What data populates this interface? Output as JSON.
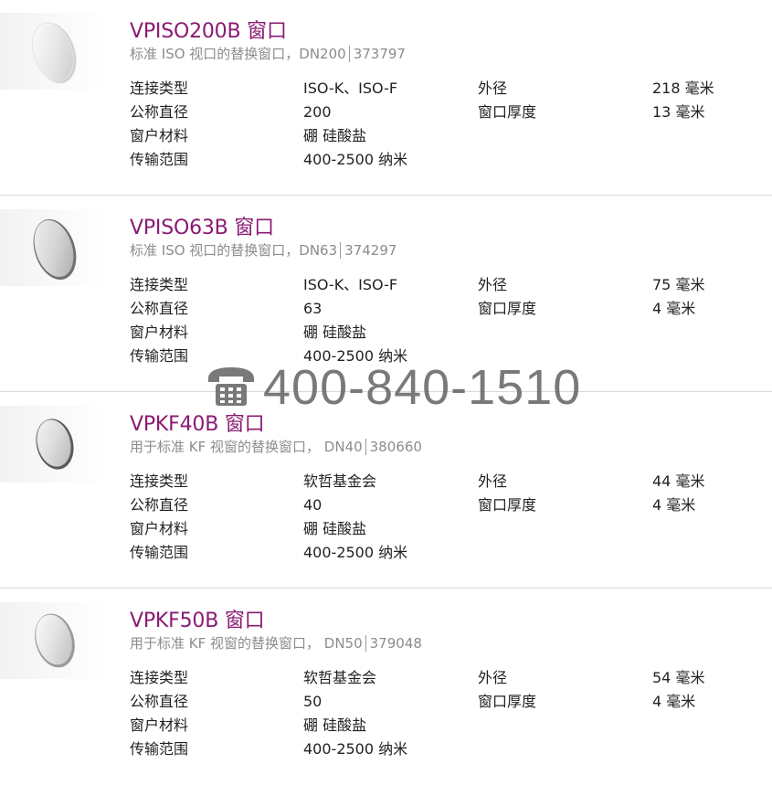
{
  "products": [
    {
      "title": "VPISO200B 窗口",
      "desc": "标准 ISO 视口的替换窗口，DN200",
      "part_no": "373797",
      "specs": [
        {
          "label": "连接类型",
          "value": "ISO-K、ISO-F",
          "label2": "外径",
          "value2": "218 毫米"
        },
        {
          "label": "公称直径",
          "value": "200",
          "label2": "窗口厚度",
          "value2": "13 毫米"
        },
        {
          "label": "窗户材料",
          "value": "硼 硅酸盐",
          "label2": "",
          "value2": ""
        },
        {
          "label": "传输范围",
          "value": "400-2500 纳米",
          "label2": "",
          "value2": ""
        }
      ]
    },
    {
      "title": "VPISO63B 窗口",
      "desc": "标准 ISO 视口的替换窗口，DN63",
      "part_no": "374297",
      "specs": [
        {
          "label": "连接类型",
          "value": "ISO-K、ISO-F",
          "label2": "外径",
          "value2": "75 毫米"
        },
        {
          "label": "公称直径",
          "value": "63",
          "label2": "窗口厚度",
          "value2": "4 毫米"
        },
        {
          "label": "窗户材料",
          "value": "硼 硅酸盐",
          "label2": "",
          "value2": ""
        },
        {
          "label": "传输范围",
          "value": "400-2500 纳米",
          "label2": "",
          "value2": ""
        }
      ]
    },
    {
      "title": "VPKF40B 窗口",
      "desc": "用于标准 KF 视窗的替换窗口， DN40",
      "part_no": "380660",
      "specs": [
        {
          "label": "连接类型",
          "value": "软哲基金会",
          "label2": "外径",
          "value2": "44 毫米"
        },
        {
          "label": "公称直径",
          "value": "40",
          "label2": "窗口厚度",
          "value2": "4 毫米"
        },
        {
          "label": "窗户材料",
          "value": "硼 硅酸盐",
          "label2": "",
          "value2": ""
        },
        {
          "label": "传输范围",
          "value": "400-2500 纳米",
          "label2": "",
          "value2": ""
        }
      ]
    },
    {
      "title": "VPKF50B 窗口",
      "desc": "用于标准 KF 视窗的替换窗口， DN50",
      "part_no": "379048",
      "specs": [
        {
          "label": "连接类型",
          "value": "软哲基金会",
          "label2": "外径",
          "value2": "54 毫米"
        },
        {
          "label": "公称直径",
          "value": "50",
          "label2": "窗口厚度",
          "value2": "4 毫米"
        },
        {
          "label": "窗户材料",
          "value": "硼 硅酸盐",
          "label2": "",
          "value2": ""
        },
        {
          "label": "传输范围",
          "value": "400-2500 纳米",
          "label2": "",
          "value2": ""
        }
      ]
    }
  ],
  "watermark": {
    "icon": "telephone-icon",
    "phone": "400-840-1510"
  },
  "colors": {
    "title": "#8b1a73",
    "subtitle": "#8c8c8c",
    "divider": "#d9d9d9"
  }
}
